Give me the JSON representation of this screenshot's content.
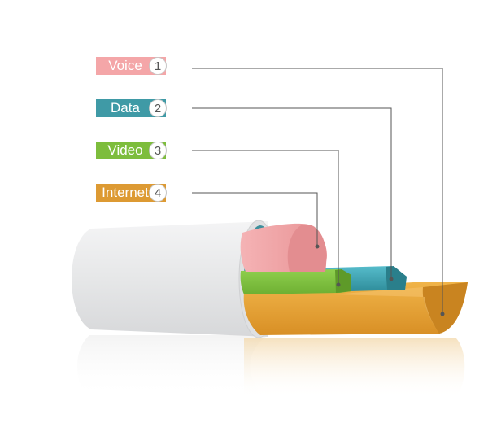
{
  "labels": [
    {
      "text": "Voice",
      "number": "1",
      "color": "#f4a6a8"
    },
    {
      "text": "Data",
      "number": "2",
      "color": "#3f9aa6"
    },
    {
      "text": "Video",
      "number": "3",
      "color": "#7dbd3c"
    },
    {
      "text": "Internet",
      "number": "4",
      "color": "#dd9a33"
    }
  ],
  "colors": {
    "cable_sheath": "#e8e9ea",
    "voice": "#f0a2a4",
    "data": "#3ea4b3",
    "video": "#7ec43f",
    "internet": "#e0a036",
    "leader_line": "#555555"
  }
}
